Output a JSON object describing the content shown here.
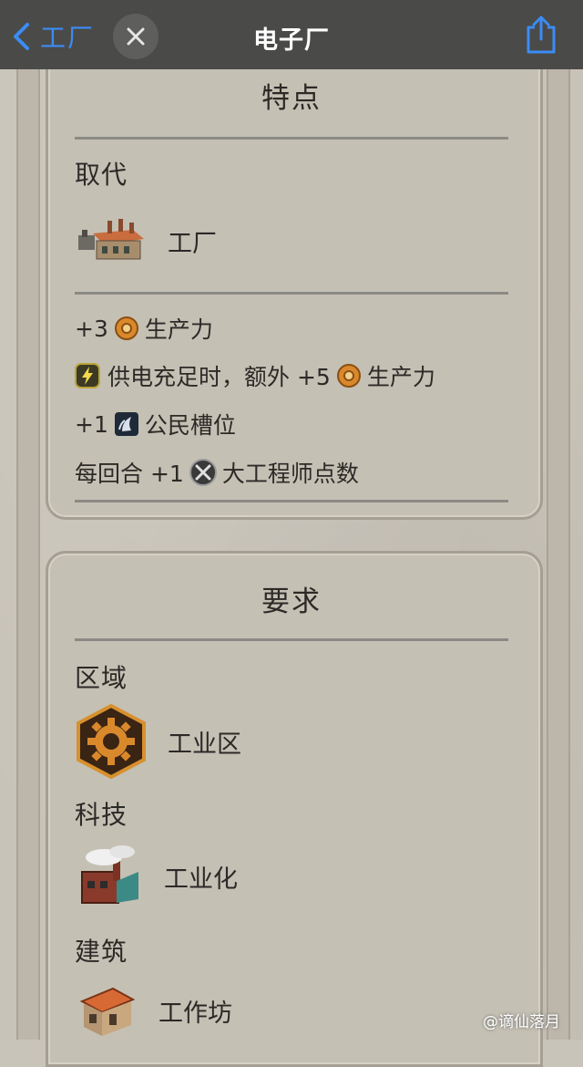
{
  "nav": {
    "back_label": "工厂",
    "title": "电子厂"
  },
  "features": {
    "title": "特点",
    "replaces_label": "取代",
    "replaces_item": "工厂",
    "bonuses": [
      {
        "prefix": "+3",
        "text": "生产力"
      },
      {
        "prefix": "供电充足时，额外 +5",
        "text": "生产力"
      },
      {
        "prefix": "+1",
        "text": "公民槽位"
      },
      {
        "prefix": "每回合 +1",
        "text": "大工程师点数"
      }
    ]
  },
  "requirements": {
    "title": "要求",
    "district_label": "区域",
    "district_item": "工业区",
    "tech_label": "科技",
    "tech_item": "工业化",
    "building_label": "建筑",
    "building_item": "工作坊"
  },
  "watermark": "@谪仙落月",
  "colors": {
    "accent": "#3b8cf5",
    "navbar": "#4a4a48"
  }
}
